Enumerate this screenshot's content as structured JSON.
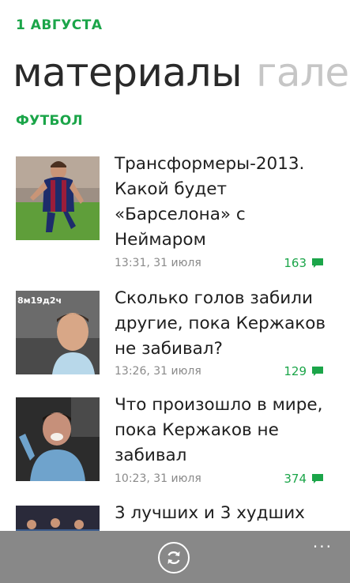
{
  "header": {
    "date": "1 АВГУСТА",
    "pivot_active": "материалы",
    "pivot_next": "галерея"
  },
  "section_title": "ФУТБОЛ",
  "articles": [
    {
      "title": "Трансформеры-2013. Какой будет «Барселона» с Неймаром",
      "time": "13:31, 31 июля",
      "comments": "163",
      "overlay": ""
    },
    {
      "title": "Сколько голов забили другие, пока Кержаков не забивал?",
      "time": "13:26, 31 июля",
      "comments": "129",
      "overlay": "8м19д2ч"
    },
    {
      "title": "Что произошло в мире, пока Кержаков не забивал",
      "time": "10:23, 31 июля",
      "comments": "374",
      "overlay": ""
    },
    {
      "title": "3 лучших и 3 худших",
      "time": "",
      "comments": "",
      "overlay": ""
    }
  ],
  "appbar": {
    "refresh_icon": "refresh-icon",
    "more_label": "..."
  },
  "colors": {
    "accent": "#1ba549",
    "appbar": "#888888"
  }
}
